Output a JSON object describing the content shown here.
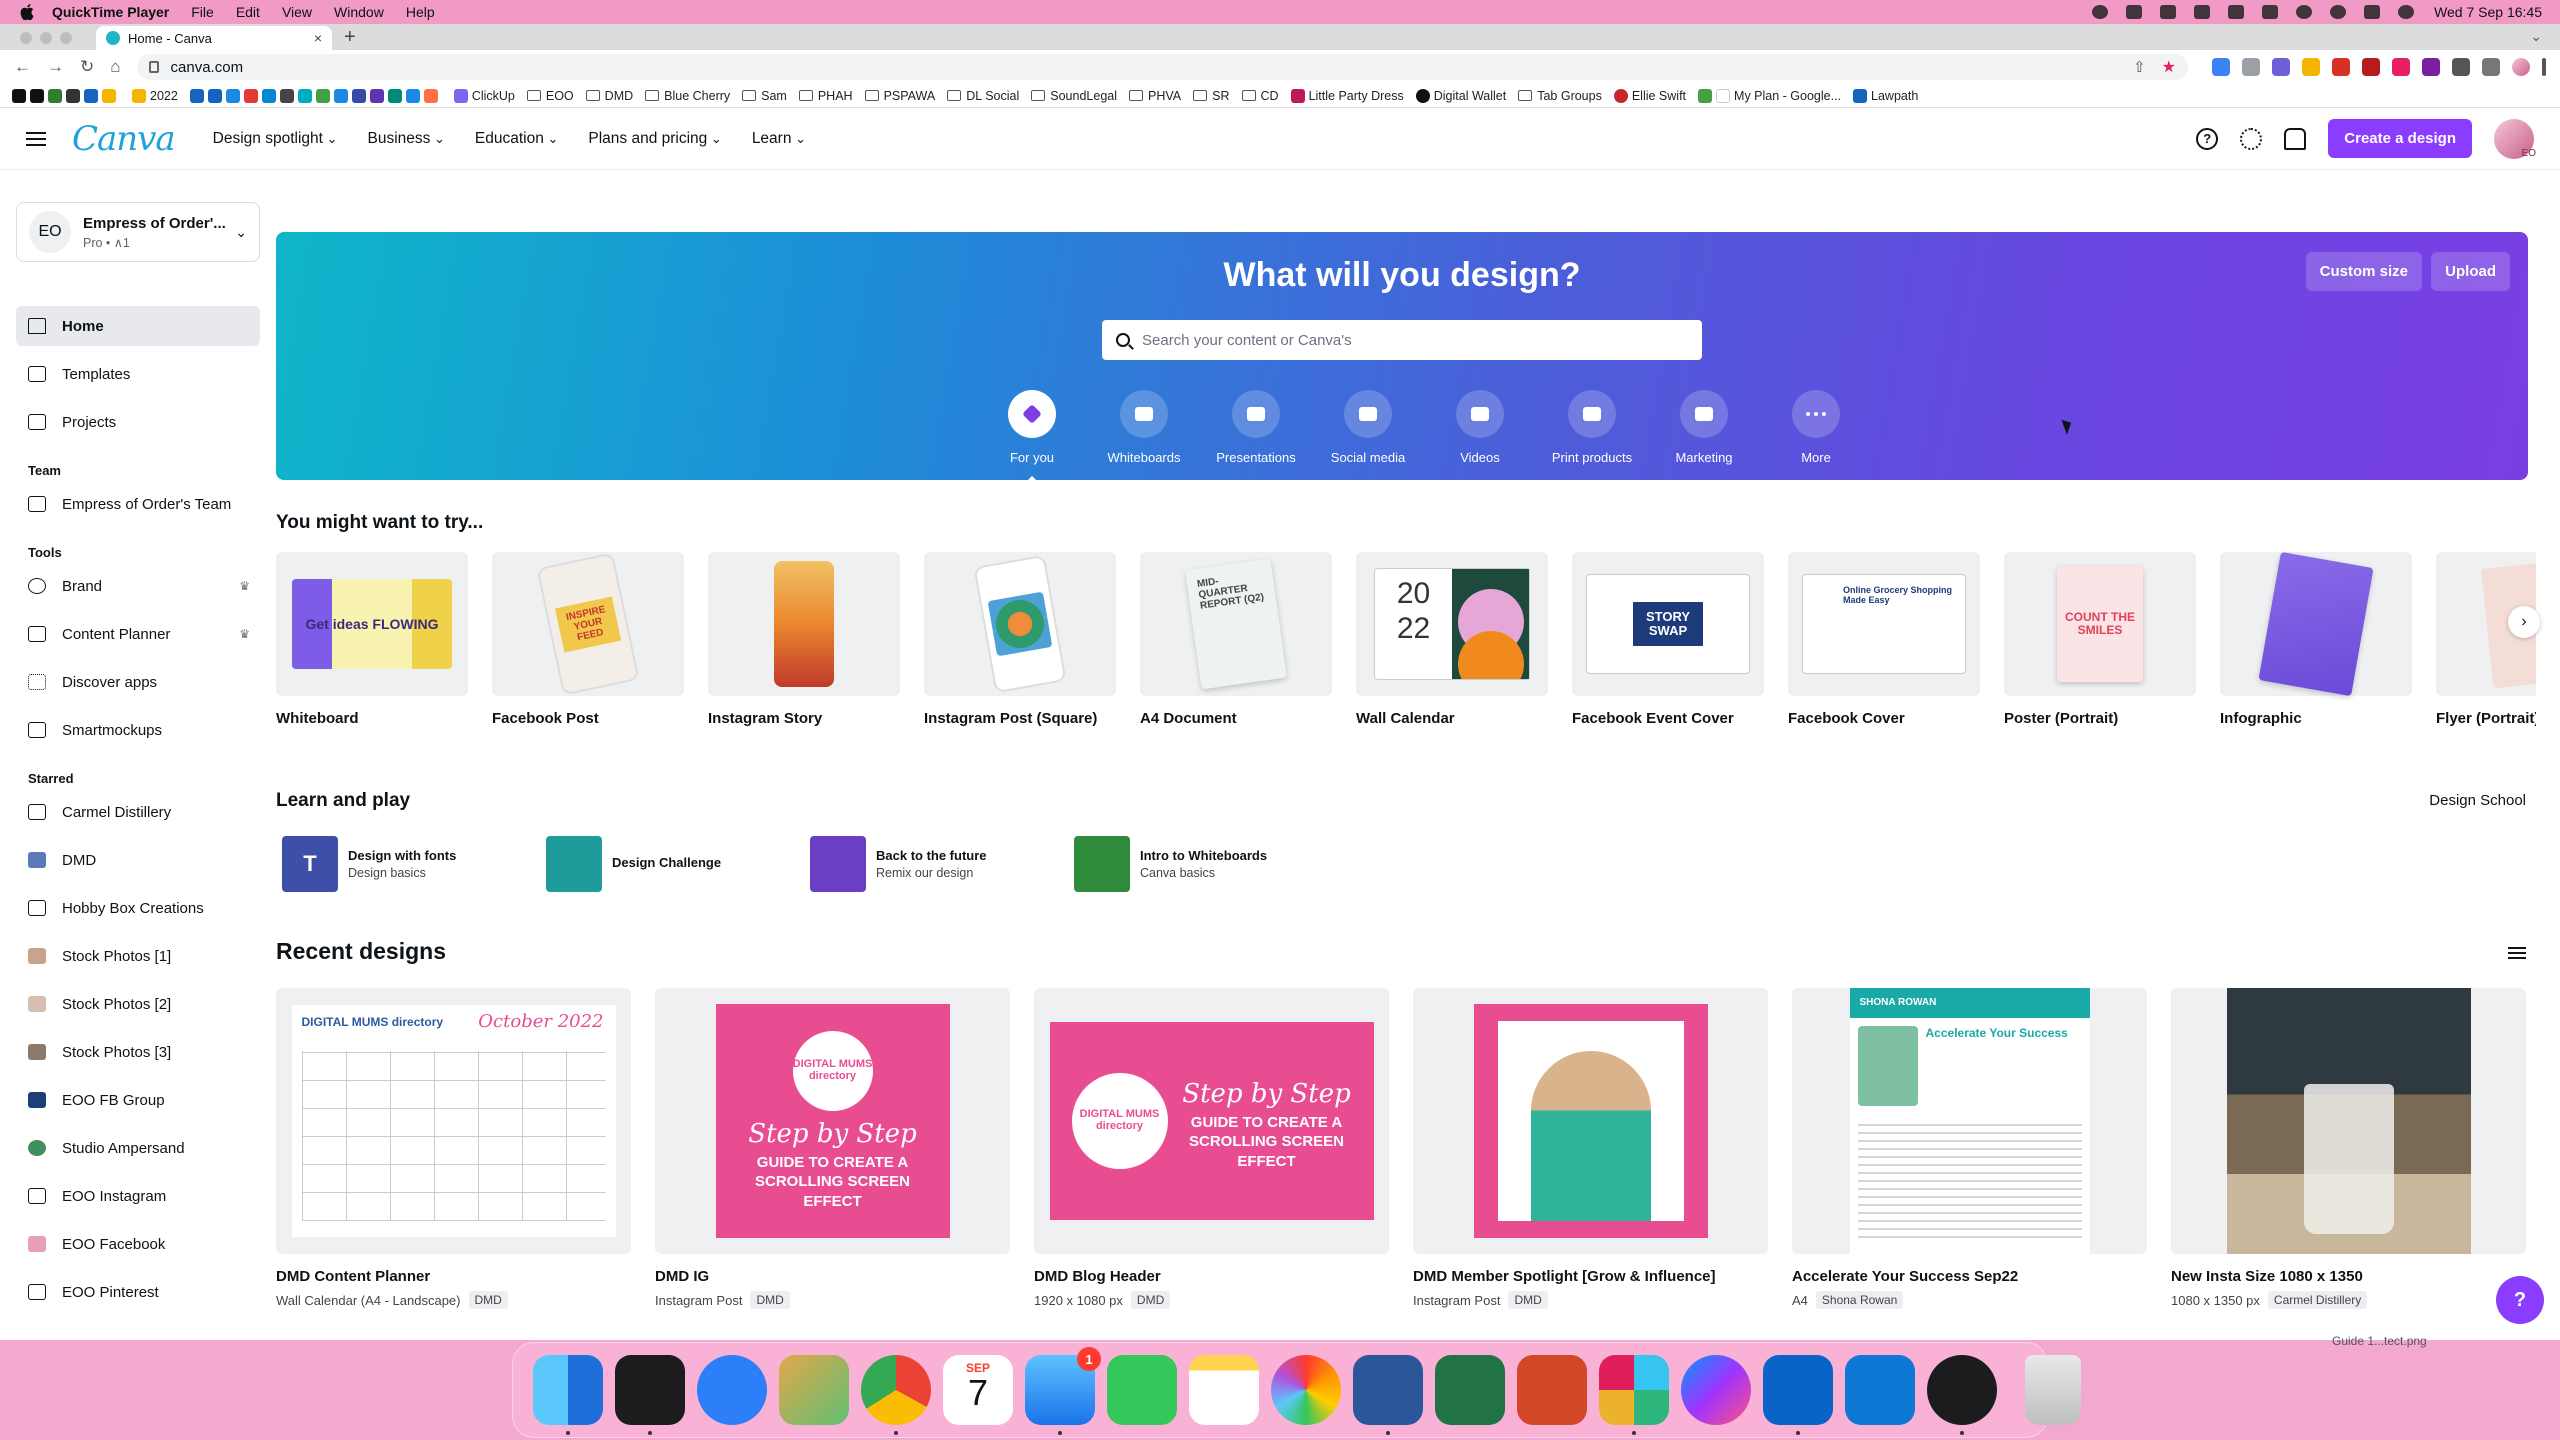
{
  "menubar": {
    "app_name": "QuickTime Player",
    "items": [
      "File",
      "Edit",
      "View",
      "Window",
      "Help"
    ],
    "clock": "Wed 7 Sep  16:45"
  },
  "browser": {
    "tab_title": "Home - Canva",
    "url": "canva.com",
    "bookmarks": [
      "2022",
      "ClickUp",
      "EOO",
      "DMD",
      "Blue Cherry",
      "Sam",
      "PHAH",
      "PSPAWA",
      "DL Social",
      "SoundLegal",
      "PHVA",
      "SR",
      "CD",
      "Little Party Dress",
      "Digital Wallet",
      "Tab Groups",
      "Ellie Swift",
      "My Plan - Google...",
      "Lawpath"
    ]
  },
  "header": {
    "logo": "Canva",
    "nav": [
      "Design spotlight",
      "Business",
      "Education",
      "Plans and pricing",
      "Learn"
    ],
    "create_label": "Create a design",
    "avatar_initials": "EO",
    "help_glyph": "?"
  },
  "sidebar": {
    "team": {
      "initials": "EO",
      "name": "Empress of Order'...",
      "sub": "Pro • ∧1"
    },
    "main": [
      "Home",
      "Templates",
      "Projects"
    ],
    "team_heading": "Team",
    "team_items": [
      "Empress of Order's Team"
    ],
    "tools_heading": "Tools",
    "tools": [
      "Brand",
      "Content Planner",
      "Discover apps",
      "Smartmockups"
    ],
    "starred_heading": "Starred",
    "starred": [
      "Carmel Distillery",
      "DMD",
      "Hobby Box Creations",
      "Stock Photos [1]",
      "Stock Photos [2]",
      "Stock Photos [3]",
      "EOO FB Group",
      "Studio Ampersand",
      "EOO Instagram",
      "EOO Facebook",
      "EOO Pinterest"
    ]
  },
  "hero": {
    "title": "What will you design?",
    "custom_size": "Custom size",
    "upload": "Upload",
    "search_placeholder": "Search your content or Canva's",
    "categories": [
      "For you",
      "Whiteboards",
      "Presentations",
      "Social media",
      "Videos",
      "Print products",
      "Marketing",
      "More"
    ]
  },
  "try": {
    "title": "You might want to try...",
    "items": [
      "Whiteboard",
      "Facebook Post",
      "Instagram Story",
      "Instagram Post (Square)",
      "A4 Document",
      "Wall Calendar",
      "Facebook Event Cover",
      "Facebook Cover",
      "Poster (Portrait)",
      "Infographic",
      "Flyer (Portrait)"
    ],
    "thumb_texts": {
      "whiteboard": "Get ideas FLOWING",
      "fb_post": "INSPIRE YOUR FEED",
      "a4": "MID-QUARTER REPORT (Q2)",
      "calendar_top": "20",
      "calendar_bottom": "22",
      "event": "STORY SWAP",
      "fb_cover": "Online Grocery Shopping Made Easy",
      "poster": "COUNT THE SMILES"
    }
  },
  "learn": {
    "title": "Learn and play",
    "link": "Design School",
    "items": [
      {
        "title": "Design with fonts",
        "sub": "Design basics",
        "icon_text": "T"
      },
      {
        "title": "Design Challenge",
        "sub": ""
      },
      {
        "title": "Back to the future",
        "sub": "Remix our design"
      },
      {
        "title": "Intro to Whiteboards",
        "sub": "Canva basics"
      }
    ]
  },
  "recent": {
    "title": "Recent designs",
    "items": [
      {
        "title": "DMD Content Planner",
        "meta": "Wall Calendar (A4 - Landscape)",
        "tag": "DMD"
      },
      {
        "title": "DMD IG",
        "meta": "Instagram Post",
        "tag": "DMD"
      },
      {
        "title": "DMD Blog Header",
        "meta": "1920 x 1080 px",
        "tag": "DMD"
      },
      {
        "title": "DMD Member Spotlight [Grow & Influence]",
        "meta": "Instagram Post",
        "tag": "DMD"
      },
      {
        "title": "Accelerate Your Success Sep22",
        "meta": "A4",
        "tag": "Shona Rowan"
      },
      {
        "title": "New Insta Size 1080 x 1350",
        "meta": "1080 x 1350 px",
        "tag": "Carmel Distillery"
      }
    ],
    "thumb_texts": {
      "planner_brand": "DIGITAL MUMS directory",
      "planner_month": "October 2022",
      "circle": "DIGITAL MUMS directory",
      "step": "Step by Step",
      "guide": "GUIDE TO CREATE A SCROLLING SCREEN EFFECT",
      "accelerate_name": "SHONA ROWAN",
      "accelerate_heading": "Accelerate Your Success"
    }
  },
  "desktop_file": "Guide 1...tect.png",
  "dock": {
    "calendar_month": "SEP",
    "calendar_day": "7",
    "mail_badge": "1"
  },
  "help_fab": "?"
}
